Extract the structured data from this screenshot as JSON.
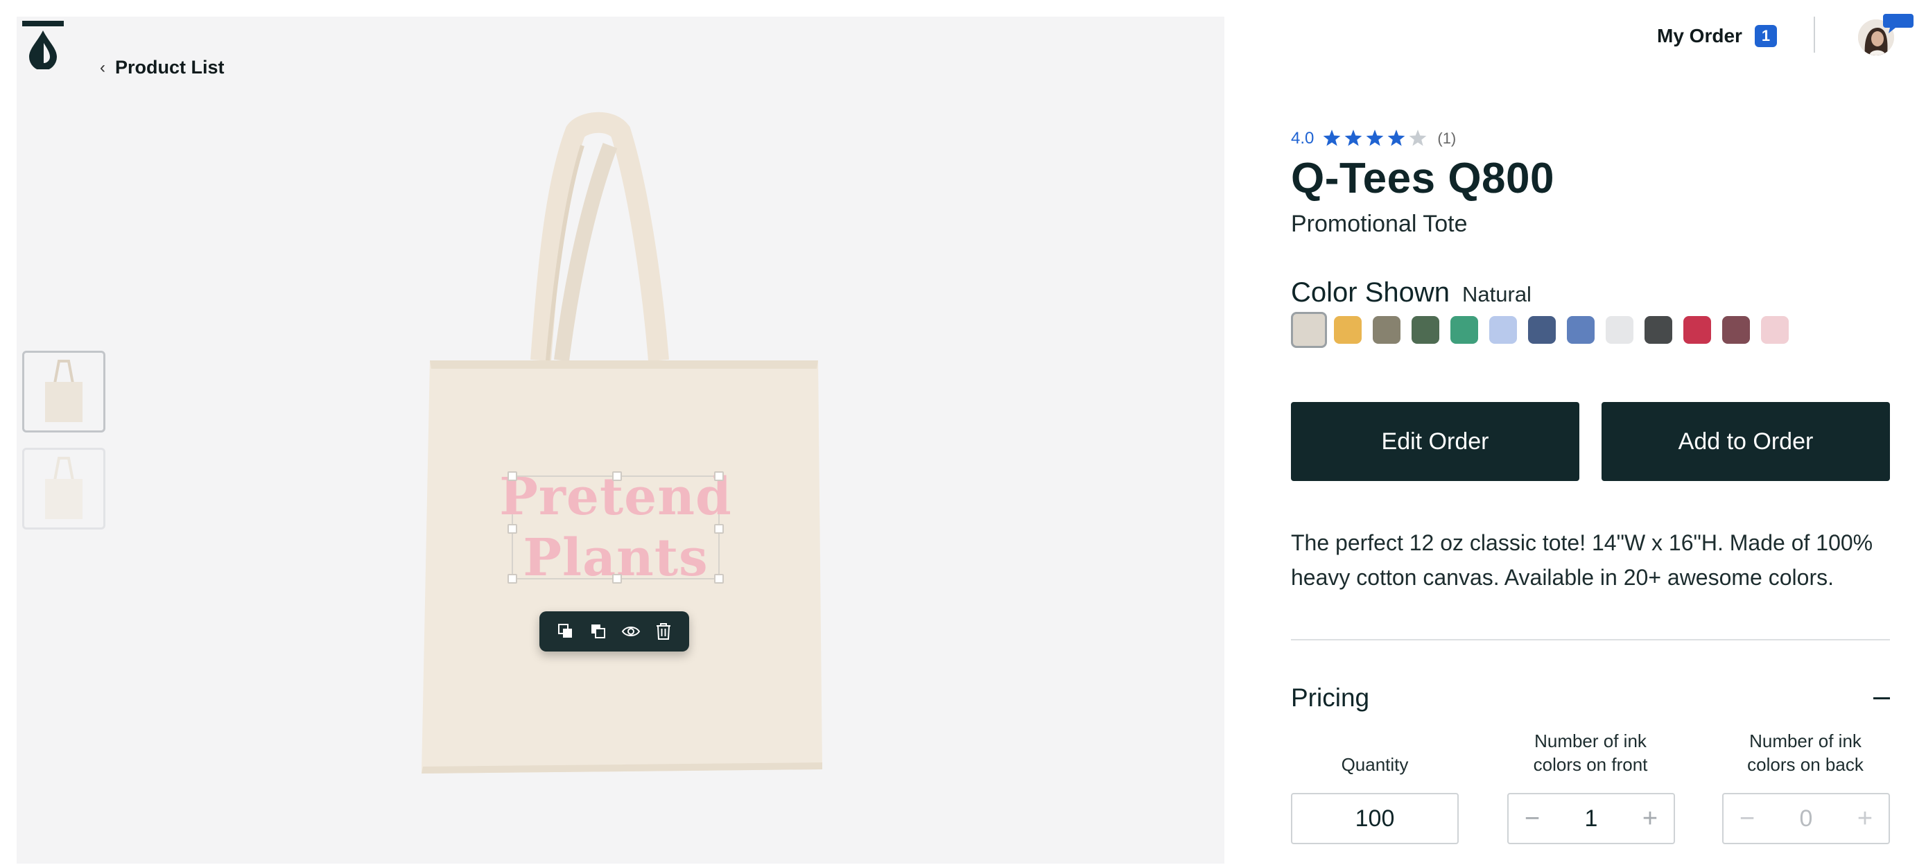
{
  "nav": {
    "back_label": "Product List"
  },
  "header": {
    "my_order_label": "My Order",
    "order_count": "1"
  },
  "design": {
    "line1": "Pretend",
    "line2": "Plants"
  },
  "product": {
    "rating": "4.0",
    "rating_stars_filled": 4,
    "rating_stars_total": 5,
    "review_count": "(1)",
    "title": "Q-Tees Q800",
    "subtitle": "Promotional Tote",
    "color_label": "Color Shown",
    "color_value": "Natural",
    "swatches": [
      {
        "color": "#dcd6cc",
        "selected": true
      },
      {
        "color": "#e9b551"
      },
      {
        "color": "#87826f"
      },
      {
        "color": "#4e6b52"
      },
      {
        "color": "#3f9f7c"
      },
      {
        "color": "#b8c9ec"
      },
      {
        "color": "#465d86"
      },
      {
        "color": "#5f80bd"
      },
      {
        "color": "#e6e7e9"
      },
      {
        "color": "#474a4b"
      },
      {
        "color": "#c8344e"
      },
      {
        "color": "#7f4b54"
      },
      {
        "color": "#f1cfd4"
      }
    ],
    "edit_button": "Edit Order",
    "add_button": "Add to Order",
    "description": "The perfect 12 oz classic tote! 14\"W x 16\"H. Made of 100% heavy cotton canvas. Available in 20+ awesome colors."
  },
  "pricing": {
    "title": "Pricing",
    "quantity_label": "Quantity",
    "quantity_value": "100",
    "front_label_1": "Number of ink",
    "front_label_2": "colors on front",
    "front_value": "1",
    "back_label_1": "Number of ink",
    "back_label_2": "colors on back",
    "back_value": "0",
    "minus": "−",
    "plus": "+"
  },
  "colors": {
    "accent": "#1f63d2",
    "primary_dark": "#12282b",
    "design_pink": "#f2b9c2"
  }
}
